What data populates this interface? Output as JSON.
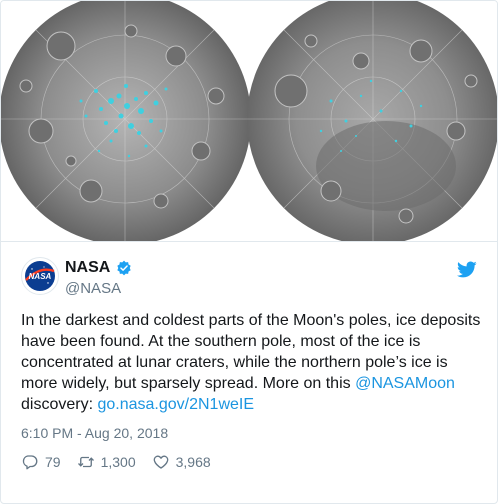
{
  "tweet": {
    "author_name": "NASA",
    "author_handle": "@NASA",
    "avatar_text": "NASA",
    "text_part1": "In the darkest and coldest parts of the Moon's poles, ice deposits have been found. At the southern pole, most of the ice is concentrated at lunar craters, while the northern pole’s ice is more widely, but sparsely spread. More on this ",
    "mention": "@NASAMoon",
    "text_part2": " discovery: ",
    "link": "go.nasa.gov/2N1weIE",
    "timestamp": "6:10 PM - Aug 20, 2018",
    "replies": "79",
    "retweets": "1,300",
    "likes": "3,968"
  },
  "media": {
    "left_moon": "south-pole-map",
    "right_moon": "north-pole-map"
  },
  "colors": {
    "link": "#1b95e0",
    "text": "#14171a",
    "secondary": "#657786",
    "ice": "#3fd0e0",
    "moon": "#8a8a8a"
  }
}
